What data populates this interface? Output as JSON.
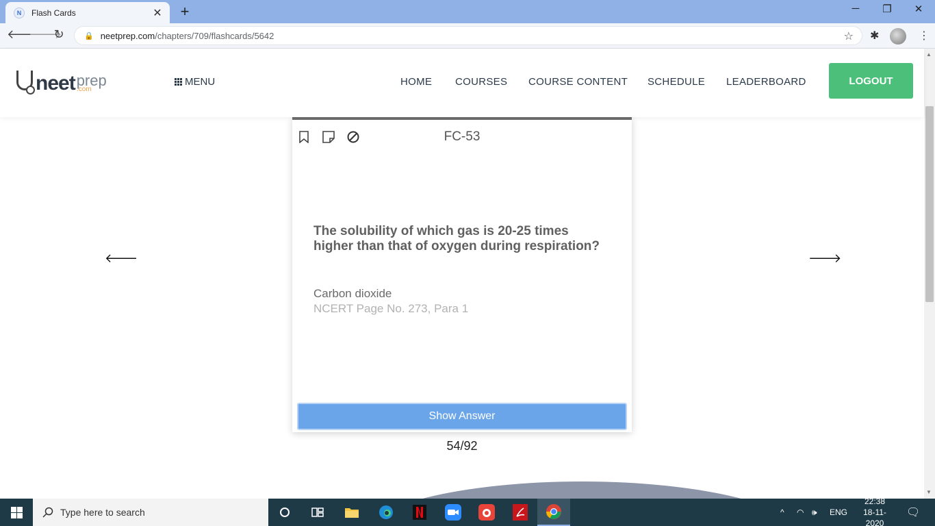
{
  "browser": {
    "tab_title": "Flash Cards",
    "tab_favicon": "N",
    "tab_close": "✕",
    "new_tab": "+",
    "url_host": "neetprep.com",
    "url_path": "/chapters/709/flashcards/5642",
    "window_controls": {
      "minimize": "─",
      "maximize": "❐",
      "close": "✕"
    }
  },
  "site": {
    "logo_neet": "neet",
    "logo_prep": "prep",
    "logo_com": ".com",
    "menu_label": "MENU",
    "nav": [
      "HOME",
      "COURSES",
      "COURSE CONTENT",
      "SCHEDULE",
      "LEADERBOARD"
    ],
    "logout_label": "LOGOUT"
  },
  "flashcard": {
    "id": "FC-53",
    "question": "The solubility of which gas is 20-25 times higher than that of oxygen during respiration?",
    "answer": "Carbon dioxide",
    "reference": "NCERT Page No. 273, Para 1",
    "show_answer_label": "Show Answer",
    "counter": "54/92"
  },
  "taskbar": {
    "search_placeholder": "Type here to search",
    "lang": "ENG",
    "time": "22:38",
    "date": "18-11-2020"
  },
  "colors": {
    "logout_bg": "#4cc07a",
    "show_answer_bg": "#6aa5ea",
    "tabbar_bg": "#8fb1e6",
    "taskbar_bg": "#1f3a47"
  }
}
